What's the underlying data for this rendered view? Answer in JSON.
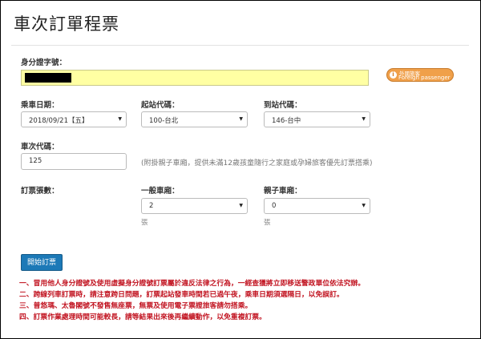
{
  "page": {
    "title": "車次訂單程票"
  },
  "id_section": {
    "label": "身分證字號：",
    "value": "",
    "foreign_button": {
      "line1": "外國旅客",
      "line2": "Foreign passenger"
    }
  },
  "ride_date": {
    "label": "乘車日期：",
    "value": "2018/09/21【五】"
  },
  "from_station": {
    "label": "起站代碼：",
    "value": "100-台北"
  },
  "to_station": {
    "label": "到站代碼：",
    "value": "146-台中"
  },
  "train_no": {
    "label": "車次代碼：",
    "value": "125",
    "hint": "(附掛親子車廂，提供未滿12歲孩童隨行之家庭或孕婦旅客優先訂票搭乘)"
  },
  "tickets": {
    "label": "訂票張數：",
    "general": {
      "label": "一般車廂：",
      "value": "2",
      "unit": "張"
    },
    "family": {
      "label": "親子車廂：",
      "value": "0",
      "unit": "張"
    }
  },
  "submit_label": "開始訂票",
  "notices": [
    "一、冒用他人身分證號及使用虛擬身分證號訂票屬於違反法律之行為，一經查獲將立即移送警政單位依法究辦。",
    "二、跨線列車訂票時，請注意跨日問題，訂票起站發車時間若已過午夜，乘車日期須選隔日，以免誤訂。",
    "三、普悠瑪、太魯閣號不發售無座票，無票及使用電子票證旅客請勿搭乘。",
    "四、訂票作業處理時間可能較長，請等結果出來後再繼續動作，以免重複訂票。"
  ],
  "colors": {
    "id_field_bg": "#ffffa3",
    "button": "#1c79b7",
    "notice": "#c1121f",
    "foreign_button": "#f0a04a"
  }
}
